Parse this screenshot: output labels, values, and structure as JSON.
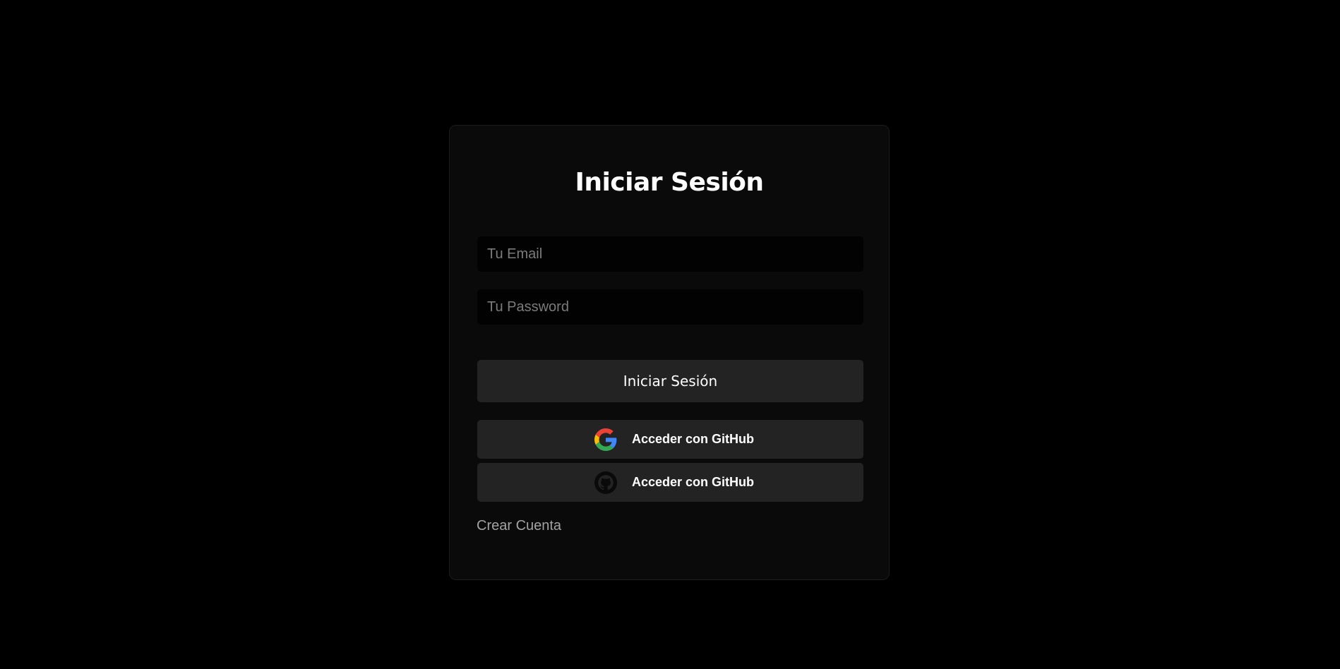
{
  "login": {
    "title": "Iniciar Sesión",
    "email_placeholder": "Tu Email",
    "password_placeholder": "Tu Password",
    "submit_label": "Iniciar Sesión",
    "google_label": "Acceder con GitHub",
    "google_icon": "google-icon",
    "github_label": "Acceder con GitHub",
    "github_icon": "github-icon",
    "create_account_label": "Crear Cuenta"
  },
  "colors": {
    "page_background": "#000000",
    "card_background": "#0a0a0a",
    "input_background": "#020202",
    "button_background": "#232323",
    "text_primary": "#ffffff",
    "text_muted": "#a3a3a3"
  }
}
